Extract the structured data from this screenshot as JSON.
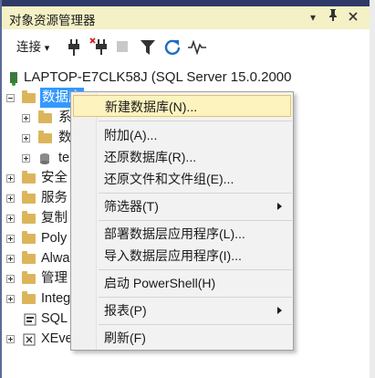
{
  "panel": {
    "title": "对象资源管理器",
    "buttons": {
      "dropdown": "▾",
      "pin": "⊣",
      "close": "✕"
    }
  },
  "toolbar": {
    "connect_label": "连接",
    "connect_arrow": "▾"
  },
  "tree": {
    "server": "LAPTOP-E7CLK58J (SQL Server 15.0.2000",
    "databases": "数据库",
    "db_children": [
      "系",
      "数",
      "te"
    ],
    "nodes": [
      "安全",
      "服务",
      "复制",
      "Poly",
      "Alwa",
      "管理",
      "Integ",
      "SQL",
      "XEve"
    ]
  },
  "menu": {
    "items": [
      {
        "label": "新建数据库(N)...",
        "submenu": false
      },
      {
        "label": "附加(A)...",
        "submenu": false
      },
      {
        "label": "还原数据库(R)...",
        "submenu": false
      },
      {
        "label": "还原文件和文件组(E)...",
        "submenu": false
      },
      {
        "label": "筛选器(T)",
        "submenu": true
      },
      {
        "label": "部署数据层应用程序(L)...",
        "submenu": false
      },
      {
        "label": "导入数据层应用程序(I)...",
        "submenu": false
      },
      {
        "label": "启动 PowerShell(H)",
        "submenu": false
      },
      {
        "label": "报表(P)",
        "submenu": true
      },
      {
        "label": "刷新(F)",
        "submenu": false
      }
    ]
  },
  "colors": {
    "titlebar_bg": "#f3f1c5",
    "selection": "#3399ff",
    "menu_hover": "#fcf3be",
    "folder": "#dcb55b"
  }
}
